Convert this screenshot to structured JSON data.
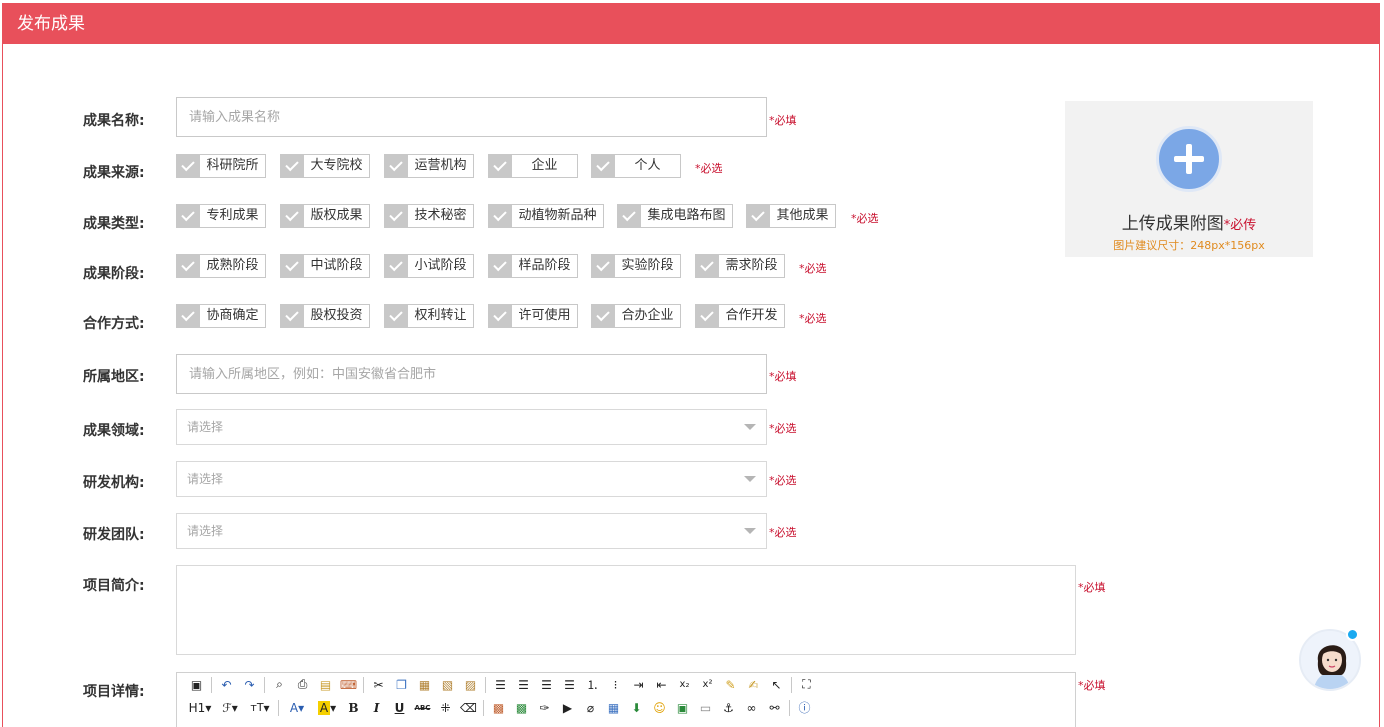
{
  "header": {
    "title": "发布成果"
  },
  "required_fill": "*必填",
  "required_select": "*必选",
  "fields": {
    "name": {
      "label": "成果名称:",
      "placeholder": "请输入成果名称"
    },
    "source": {
      "label": "成果来源:",
      "options": [
        "科研院所",
        "大专院校",
        "运营机构",
        "企业",
        "个人"
      ]
    },
    "type": {
      "label": "成果类型:",
      "options": [
        "专利成果",
        "版权成果",
        "技术秘密",
        "动植物新品种",
        "集成电路布图",
        "其他成果"
      ]
    },
    "stage": {
      "label": "成果阶段:",
      "options": [
        "成熟阶段",
        "中试阶段",
        "小试阶段",
        "样品阶段",
        "实验阶段",
        "需求阶段"
      ]
    },
    "coop": {
      "label": "合作方式:",
      "options": [
        "协商确定",
        "股权投资",
        "权利转让",
        "许可使用",
        "合办企业",
        "合作开发"
      ]
    },
    "region": {
      "label": "所属地区:",
      "placeholder": "请输入所属地区，例如：中国安徽省合肥市"
    },
    "domain": {
      "label": "成果领域:",
      "value": "请选择"
    },
    "org": {
      "label": "研发机构:",
      "value": "请选择"
    },
    "team": {
      "label": "研发团队:",
      "value": "请选择"
    },
    "intro": {
      "label": "项目简介:"
    },
    "detail": {
      "label": "项目详情:"
    }
  },
  "upload": {
    "title": "上传成果附图",
    "required": "*必传",
    "hint": "图片建议尺寸：248px*156px"
  },
  "toolbar": {
    "row1": [
      "source-icon",
      "undo-icon",
      "redo-icon",
      "preview-icon",
      "print-icon",
      "template-icon",
      "code-icon",
      "cut-icon",
      "copy-icon",
      "paste-icon",
      "paste-text-icon",
      "paste-word-icon",
      "align-left-icon",
      "align-center-icon",
      "align-right-icon",
      "justify-icon",
      "ordered-list-icon",
      "unordered-list-icon",
      "indent-icon",
      "outdent-icon",
      "subscript-icon",
      "superscript-icon",
      "clear-format-icon",
      "select-all-icon",
      "cursor-icon",
      "fullscreen-icon"
    ],
    "heading_label": "H1",
    "font_family_label": "ℱ",
    "font_size_label": "тT",
    "font_color_label": "A",
    "highlight_label": "A",
    "bold_label": "B",
    "italic_label": "I",
    "underline_label": "U",
    "strike_label": "ABC"
  },
  "colors": {
    "accent": "#e8505b",
    "required": "#c8102e",
    "hint": "#e08a1e",
    "upload_button": "#7ba7e6"
  }
}
